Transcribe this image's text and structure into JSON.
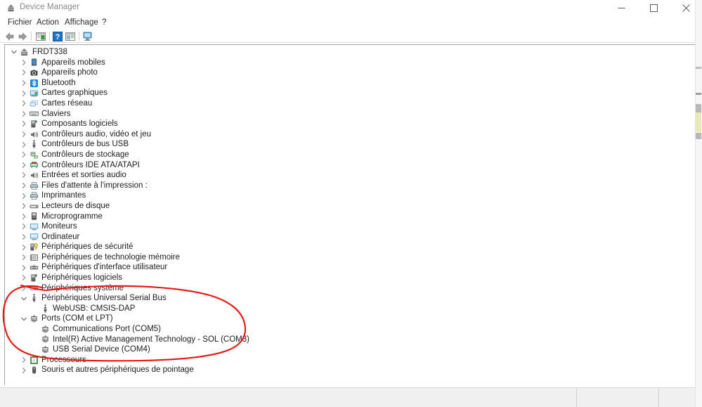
{
  "window": {
    "title": "Device Manager",
    "title_icon": "device-manager-icon",
    "minimize_label": "–",
    "maximize_label": "□",
    "close_label": "✕"
  },
  "menubar": {
    "items": [
      {
        "label": "Fichier",
        "name": "menu-fichier"
      },
      {
        "label": "Action",
        "name": "menu-action"
      },
      {
        "label": "Affichage",
        "name": "menu-affichage"
      },
      {
        "label": "?",
        "name": "menu-help"
      }
    ]
  },
  "toolbar": {
    "items": [
      {
        "name": "back-arrow-icon",
        "tooltip": "Précédent"
      },
      {
        "name": "forward-arrow-icon",
        "tooltip": "Suivant"
      },
      {
        "name": "show-hide-console-tree-icon",
        "tooltip": "Afficher/Masquer l'arborescence de la console"
      },
      {
        "name": "help-icon",
        "tooltip": "Aide"
      },
      {
        "name": "properties-icon",
        "tooltip": "Propriétés"
      },
      {
        "name": "scan-hardware-changes-icon",
        "tooltip": "Rechercher les modifications sur le matériel"
      }
    ]
  },
  "tree": {
    "root_label": "FRDT338",
    "items": [
      {
        "label": "FRDT338",
        "depth": 0,
        "expanded": true,
        "chevron": "chevron-down",
        "icon": "computer-icon",
        "icon_color": "#5b5b5b"
      },
      {
        "label": "Appareils mobiles",
        "depth": 1,
        "expanded": false,
        "chevron": "chevron-right",
        "icon": "mobile-device-icon",
        "icon_color": "#3f8fd0"
      },
      {
        "label": "Appareils photo",
        "depth": 1,
        "expanded": false,
        "chevron": "chevron-right",
        "icon": "camera-icon",
        "icon_color": "#4a4a4a"
      },
      {
        "label": "Bluetooth",
        "depth": 1,
        "expanded": false,
        "chevron": "chevron-right",
        "icon": "bluetooth-icon",
        "icon_color": "#1e88e5"
      },
      {
        "label": "Cartes graphiques",
        "depth": 1,
        "expanded": false,
        "chevron": "chevron-right",
        "icon": "display-adapter-icon",
        "icon_color": "#4d9fd6"
      },
      {
        "label": "Cartes réseau",
        "depth": 1,
        "expanded": false,
        "chevron": "chevron-right",
        "icon": "network-adapter-icon",
        "icon_color": "#6fa8dc"
      },
      {
        "label": "Claviers",
        "depth": 1,
        "expanded": false,
        "chevron": "chevron-right",
        "icon": "keyboard-icon",
        "icon_color": "#707070"
      },
      {
        "label": "Composants logiciels",
        "depth": 1,
        "expanded": false,
        "chevron": "chevron-right",
        "icon": "software-component-icon",
        "icon_color": "#3b7a3b"
      },
      {
        "label": "Contrôleurs audio, vidéo et jeu",
        "depth": 1,
        "expanded": false,
        "chevron": "chevron-right",
        "icon": "speaker-icon",
        "icon_color": "#6b6b6b"
      },
      {
        "label": "Contrôleurs de bus USB",
        "depth": 1,
        "expanded": false,
        "chevron": "chevron-right",
        "icon": "usb-icon",
        "icon_color": "#5a5a5a"
      },
      {
        "label": "Contrôleurs de stockage",
        "depth": 1,
        "expanded": false,
        "chevron": "chevron-right",
        "icon": "storage-controller-icon",
        "icon_color": "#5f8f5f"
      },
      {
        "label": "Contrôleurs IDE ATA/ATAPI",
        "depth": 1,
        "expanded": false,
        "chevron": "chevron-right",
        "icon": "ide-controller-icon",
        "icon_color": "#2e8b57"
      },
      {
        "label": "Entrées et sorties audio",
        "depth": 1,
        "expanded": false,
        "chevron": "chevron-right",
        "icon": "audio-io-icon",
        "icon_color": "#6b6b6b"
      },
      {
        "label": "Files d'attente à l'impression :",
        "depth": 1,
        "expanded": false,
        "chevron": "chevron-right",
        "icon": "print-queue-icon",
        "icon_color": "#5a7a8a"
      },
      {
        "label": "Imprimantes",
        "depth": 1,
        "expanded": false,
        "chevron": "chevron-right",
        "icon": "printer-icon",
        "icon_color": "#5a7a8a"
      },
      {
        "label": "Lecteurs de disque",
        "depth": 1,
        "expanded": false,
        "chevron": "chevron-right",
        "icon": "disk-drive-icon",
        "icon_color": "#6a6a6a"
      },
      {
        "label": "Microprogramme",
        "depth": 1,
        "expanded": false,
        "chevron": "chevron-right",
        "icon": "firmware-icon",
        "icon_color": "#4a4a4a"
      },
      {
        "label": "Moniteurs",
        "depth": 1,
        "expanded": false,
        "chevron": "chevron-right",
        "icon": "monitor-icon",
        "icon_color": "#4d9fd6"
      },
      {
        "label": "Ordinateur",
        "depth": 1,
        "expanded": false,
        "chevron": "chevron-right",
        "icon": "computer-node-icon",
        "icon_color": "#4d9fd6"
      },
      {
        "label": "Périphériques de sécurité",
        "depth": 1,
        "expanded": false,
        "chevron": "chevron-right",
        "icon": "security-device-icon",
        "icon_color": "#c9a227"
      },
      {
        "label": "Périphériques de technologie mémoire",
        "depth": 1,
        "expanded": false,
        "chevron": "chevron-right",
        "icon": "memory-device-icon",
        "icon_color": "#7a7a7a"
      },
      {
        "label": "Périphériques d'interface utilisateur",
        "depth": 1,
        "expanded": false,
        "chevron": "chevron-right",
        "icon": "hid-device-icon",
        "icon_color": "#6a6a6a"
      },
      {
        "label": "Périphériques logiciels",
        "depth": 1,
        "expanded": false,
        "chevron": "chevron-right",
        "icon": "software-device-icon",
        "icon_color": "#3b7a3b"
      },
      {
        "label": "Périphériques système",
        "depth": 1,
        "expanded": false,
        "chevron": "chevron-right",
        "icon": "system-device-icon",
        "icon_color": "#4d9fd6"
      },
      {
        "label": "Périphériques Universal Serial Bus",
        "depth": 1,
        "expanded": true,
        "chevron": "chevron-down",
        "icon": "usb-icon",
        "icon_color": "#5a5a5a"
      },
      {
        "label": "WebUSB: CMSIS-DAP",
        "depth": 2,
        "expanded": null,
        "chevron": "none",
        "icon": "usb-device-icon",
        "icon_color": "#5a5a5a"
      },
      {
        "label": "Ports (COM et LPT)",
        "depth": 1,
        "expanded": true,
        "chevron": "chevron-down",
        "icon": "port-icon",
        "icon_color": "#5a5a5a"
      },
      {
        "label": "Communications Port (COM5)",
        "depth": 2,
        "expanded": null,
        "chevron": "none",
        "icon": "port-icon",
        "icon_color": "#5a5a5a"
      },
      {
        "label": "Intel(R) Active Management Technology - SOL (COM3)",
        "depth": 2,
        "expanded": null,
        "chevron": "none",
        "icon": "port-icon",
        "icon_color": "#5a5a5a"
      },
      {
        "label": "USB Serial Device (COM4)",
        "depth": 2,
        "expanded": null,
        "chevron": "none",
        "icon": "port-icon",
        "icon_color": "#5a5a5a"
      },
      {
        "label": "Processeurs",
        "depth": 1,
        "expanded": false,
        "chevron": "chevron-right",
        "icon": "processor-icon",
        "icon_color": "#2e7d32"
      },
      {
        "label": "Souris et autres périphériques de pointage",
        "depth": 1,
        "expanded": false,
        "chevron": "chevron-right",
        "icon": "mouse-icon",
        "icon_color": "#5a5a5a"
      }
    ]
  },
  "annotation": {
    "shape": "hand-drawn-ellipse",
    "color": "#e8130f",
    "covers": "Périphériques Universal Serial Bus / Ports (COM et LPT) section"
  },
  "statusbar": {
    "cells": [
      "",
      "",
      ""
    ]
  },
  "colors": {
    "accent_blue": "#1e88e5",
    "annotation_red": "#e8130f",
    "text": "#1d1d1d",
    "title_text": "#8a8a8a",
    "panel_border": "#a3a3a3",
    "statusbar_bg": "#f0f0f0"
  }
}
